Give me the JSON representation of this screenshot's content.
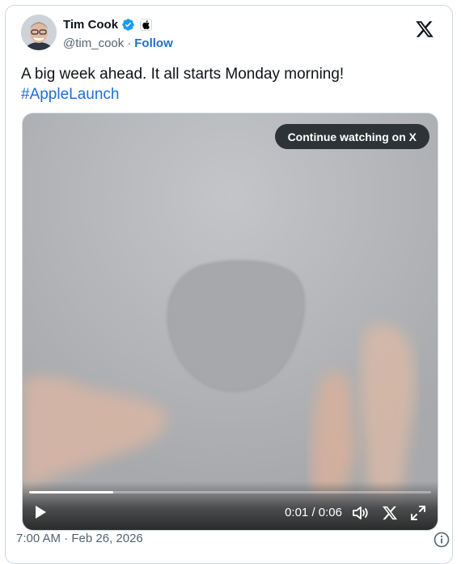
{
  "author": {
    "name": "Tim Cook",
    "handle": "@tim_cook",
    "separator": "·",
    "follow_label": "Follow",
    "verified_color": "#1d9bf0"
  },
  "tweet": {
    "text": "A big week ahead. It all starts Monday morning!",
    "hashtag": "#AppleLaunch",
    "link_color": "#1d6fd6"
  },
  "media": {
    "continue_label": "Continue watching on X",
    "current_time": "0:01",
    "time_separator": "/",
    "duration": "0:06",
    "progress_fraction": 0.21
  },
  "footer": {
    "timestamp": "7:00 AM · Feb 26, 2026"
  },
  "icons": {
    "brand": "x-logo-icon",
    "verified": "verified-badge-icon",
    "affiliation": "apple-logo-icon",
    "play": "play-icon",
    "volume": "volume-icon",
    "fullscreen": "fullscreen-icon",
    "info": "info-icon"
  }
}
